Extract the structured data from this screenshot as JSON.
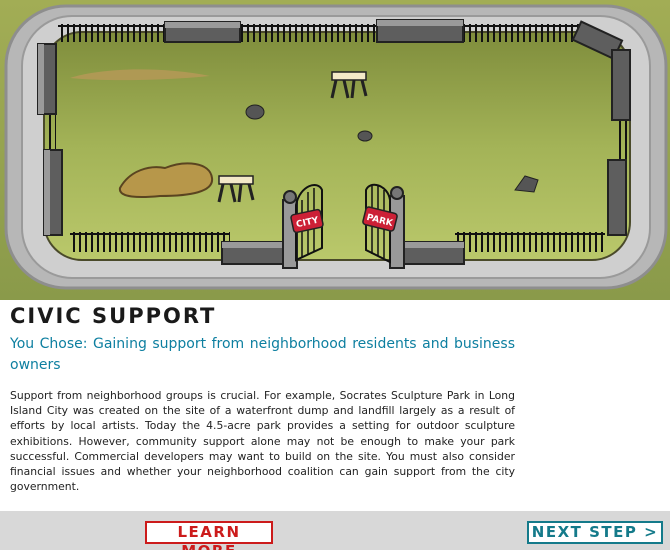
{
  "heading": "CIVIC SUPPORT",
  "choice_text": "You Chose: Gaining support from neighborhood residents and business owners",
  "body_text": "Support from neighborhood groups is crucial. For example, Socrates Sculpture Park in Long Island City was created on the site of a waterfront dump and landfill largely as a result of efforts by local artists. Today the 4.5-acre park provides a setting for outdoor sculpture exhibitions. However, community support alone may not be enough to make your park successful. Commercial developers may want to build on the site. You must also consider financial issues and whether your neighborhood coalition can gain support from the city government.",
  "gate_sign_left": "CITY",
  "gate_sign_right": "PARK",
  "buttons": {
    "learn_more": "LEARN MORE",
    "next_step": "NEXT STEP >"
  },
  "colors": {
    "accent_teal": "#0d7fa0",
    "learn_red": "#cc1b1b",
    "next_teal": "#147a8a",
    "grass": "#9bab4c",
    "footer_gray": "#d8d8d8"
  }
}
